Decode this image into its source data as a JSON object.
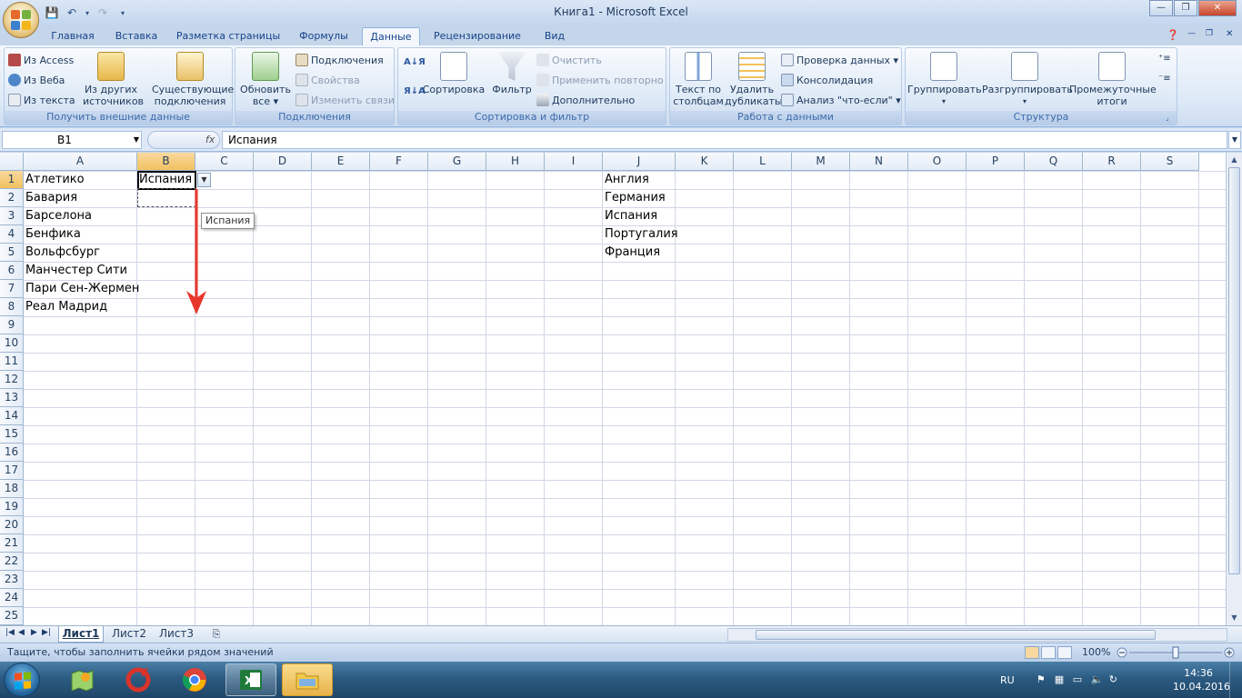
{
  "window": {
    "title": "Книга1 - Microsoft Excel",
    "min": "—",
    "max": "❐",
    "close": "✕"
  },
  "ribbon_tabs": [
    "Главная",
    "Вставка",
    "Разметка страницы",
    "Формулы",
    "Данные",
    "Рецензирование",
    "Вид"
  ],
  "active_tab": "Данные",
  "ribbon": {
    "ext_data": {
      "access": "Из Access",
      "web": "Из Веба",
      "text": "Из текста",
      "other_1": "Из других",
      "other_2": "источников ▾",
      "existing_1": "Существующие",
      "existing_2": "подключения",
      "label": "Получить внешние данные"
    },
    "connections": {
      "refresh_1": "Обновить",
      "refresh_2": "все ▾",
      "connections": "Подключения",
      "properties": "Свойства",
      "edit_links": "Изменить связи",
      "label": "Подключения"
    },
    "sort_filter": {
      "sort": "Сортировка",
      "filter": "Фильтр",
      "clear": "Очистить",
      "reapply": "Применить повторно",
      "advanced": "Дополнительно",
      "label": "Сортировка и фильтр"
    },
    "data_tools": {
      "text_cols_1": "Текст по",
      "text_cols_2": "столбцам",
      "remove_dup_1": "Удалить",
      "remove_dup_2": "дубликаты",
      "validation": "Проверка данных ▾",
      "consolidate": "Консолидация",
      "whatif": "Анализ \"что-если\" ▾",
      "label": "Работа с данными"
    },
    "outline": {
      "group": "Группировать",
      "ungroup": "Разгруппировать",
      "subtotal_1": "Промежуточные",
      "subtotal_2": "итоги",
      "label": "Структура"
    }
  },
  "formula_bar": {
    "name_box": "B1",
    "fx": "fx",
    "value": "Испания"
  },
  "columns": [
    "A",
    "B",
    "C",
    "D",
    "E",
    "F",
    "G",
    "H",
    "I",
    "J",
    "K",
    "L",
    "M",
    "N",
    "O",
    "P",
    "Q",
    "R",
    "S"
  ],
  "rows": [
    "1",
    "2",
    "3",
    "4",
    "5",
    "6",
    "7",
    "8",
    "9",
    "10",
    "11",
    "12",
    "13",
    "14",
    "15",
    "16",
    "17",
    "18",
    "19",
    "20",
    "21",
    "22",
    "23",
    "24",
    "25"
  ],
  "col_a": [
    "Атлетико",
    "Бавария",
    "Барселона",
    "Бенфика",
    "Вольфсбург",
    "Манчестер Сити",
    "Пари Сен-Жермен",
    "Реал Мадрид"
  ],
  "col_b_value": "Испания",
  "col_j": [
    "Англия",
    "Германия",
    "Испания",
    "Португалия",
    "Франция"
  ],
  "tooltip": "Испания",
  "sheets": [
    "Лист1",
    "Лист2",
    "Лист3"
  ],
  "active_sheet": "Лист1",
  "status": {
    "message": "Тащите, чтобы заполнить ячейки рядом значений",
    "zoom": "100%"
  },
  "taskbar": {
    "lang": "RU",
    "time": "14:36",
    "date": "10.04.2016"
  },
  "colors": {
    "accent": "#15428b",
    "arrow": "#e8362a",
    "selected_header": "#f1c15f"
  }
}
